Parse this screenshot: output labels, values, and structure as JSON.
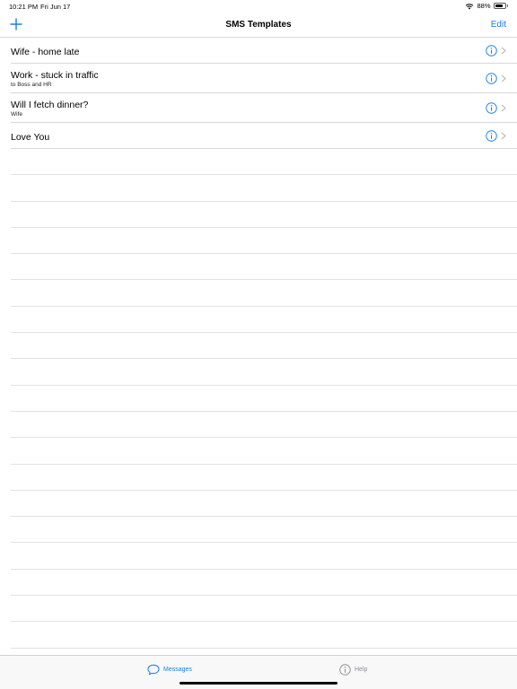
{
  "status": {
    "time": "10:21 PM",
    "date": "Fri Jun 17",
    "battery": "88%",
    "battery_level": 0.88
  },
  "nav": {
    "title": "SMS Templates",
    "edit_label": "Edit"
  },
  "templates": [
    {
      "title": "Wife - home late",
      "subtitle": ""
    },
    {
      "title": "Work - stuck in traffic",
      "subtitle": "to Boss and HR"
    },
    {
      "title": "Will I fetch dinner?",
      "subtitle": "Wife"
    },
    {
      "title": "Love You",
      "subtitle": ""
    }
  ],
  "tabs": [
    {
      "label": "Messages",
      "icon": "chat-bubble-icon",
      "selected": true
    },
    {
      "label": "Help",
      "icon": "info-icon",
      "selected": false
    }
  ],
  "colors": {
    "accent": "#1a7ee8",
    "inactive": "#8e8e93"
  }
}
